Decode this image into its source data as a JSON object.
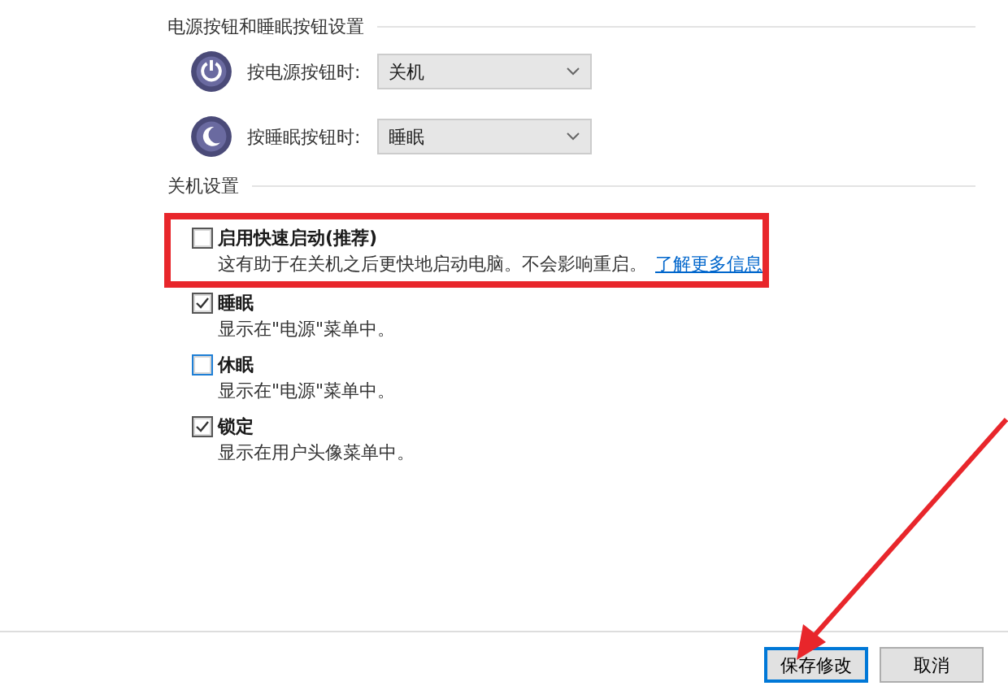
{
  "power_section": {
    "title": "电源按钮和睡眠按钮设置",
    "rows": [
      {
        "kind": "power",
        "label": "按电源按钮时:",
        "value": "关机"
      },
      {
        "kind": "sleep",
        "label": "按睡眠按钮时:",
        "value": "睡眠"
      }
    ]
  },
  "shutdown_section": {
    "title": "关机设置",
    "options": [
      {
        "label": "启用快速启动(推荐)",
        "description": "这有助于在关机之后更快地启动电脑。不会影响重启。",
        "link": "了解更多信息",
        "checked": false,
        "focused": false
      },
      {
        "label": "睡眠",
        "description": "显示在\"电源\"菜单中。",
        "checked": true,
        "focused": false
      },
      {
        "label": "休眠",
        "description": "显示在\"电源\"菜单中。",
        "checked": false,
        "focused": true
      },
      {
        "label": "锁定",
        "description": "显示在用户头像菜单中。",
        "checked": true,
        "focused": false
      }
    ]
  },
  "buttons": [
    {
      "label": "保存修改",
      "primary": true
    },
    {
      "label": "取消",
      "primary": false
    }
  ]
}
